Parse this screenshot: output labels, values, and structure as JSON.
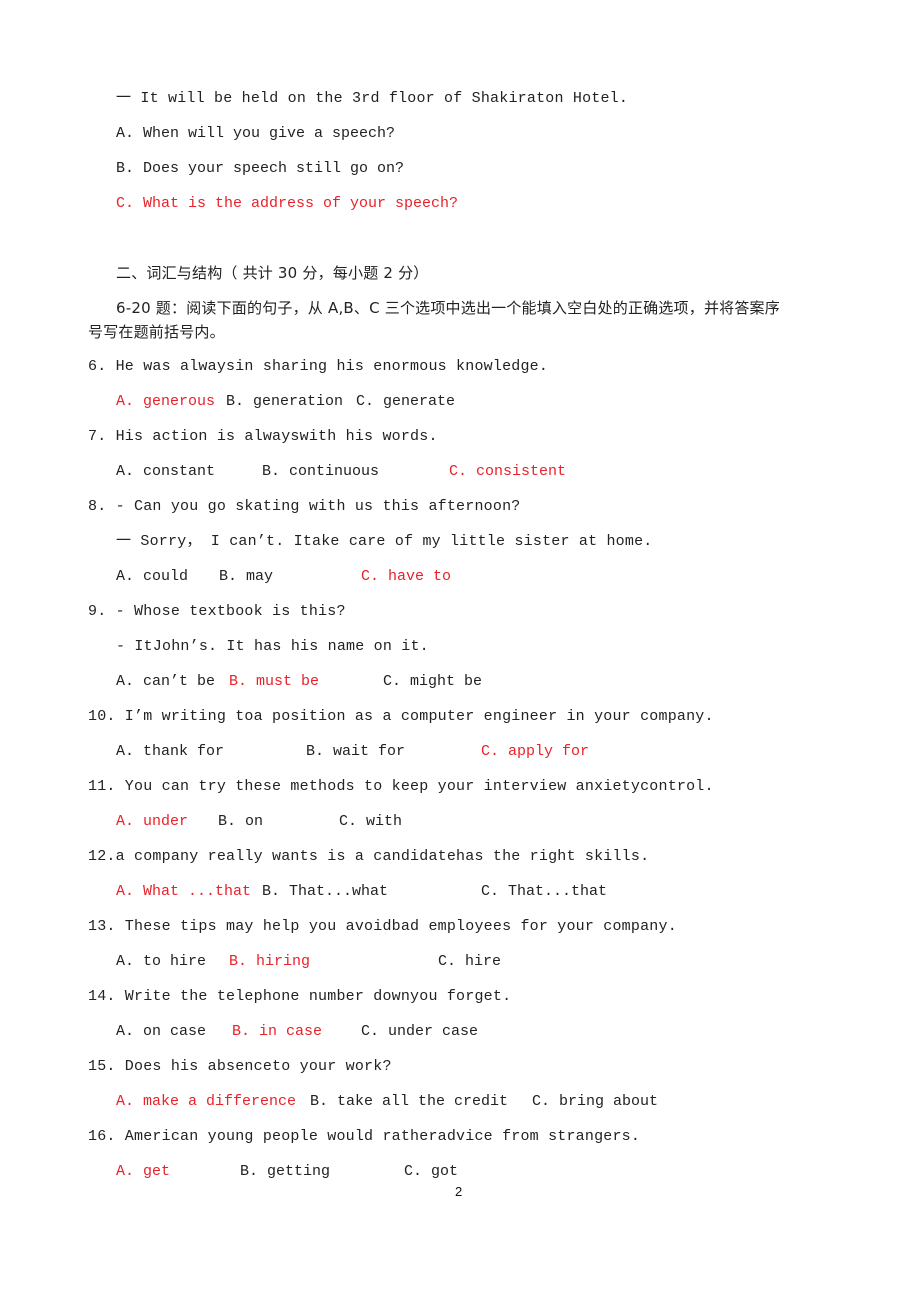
{
  "continuation": {
    "answer_line": "一 It will be held on the 3rd floor of Shakiraton Hotel.",
    "options": [
      {
        "text": "A. When will you give a speech?",
        "correct": false
      },
      {
        "text": "B. Does your speech still go on?",
        "correct": false
      },
      {
        "text": "C. What is the address of your speech?",
        "correct": true
      }
    ]
  },
  "section": {
    "heading": "二、词汇与结构（ 共计 30 分，每小题 2 分）",
    "instruction_line1": "6-20 题：阅读下面的句子，从 A,B、C 三个选项中选出一个能填入空白处的正确选项，并将答案序",
    "instruction_line2": "号写在题前括号内。"
  },
  "questions": [
    {
      "number": "6",
      "stem": "6. He was alwaysin sharing his enormous knowledge.",
      "options": [
        {
          "text": "A. generous",
          "correct": true
        },
        {
          "text": "B. generation",
          "correct": false
        },
        {
          "text": "C. generate",
          "correct": false
        }
      ]
    },
    {
      "number": "7",
      "stem": "7. His action is alwayswith his words.",
      "options": [
        {
          "text": "A. constant",
          "correct": false
        },
        {
          "text": "B. continuous",
          "correct": false
        },
        {
          "text": "C. consistent",
          "correct": true
        }
      ]
    },
    {
      "number": "8",
      "stem": "8. - Can you go skating with us this afternoon?",
      "reply": "一 Sorry， I can’t. Itake care of my little sister at home.",
      "options": [
        {
          "text": "A. could",
          "correct": false
        },
        {
          "text": "B. may",
          "correct": false
        },
        {
          "text": "C. have to",
          "correct": true
        }
      ]
    },
    {
      "number": "9",
      "stem": "9. - Whose textbook is this?",
      "reply": "- ItJohn’s. It has his name on it.",
      "options": [
        {
          "text": "A. can’t be",
          "correct": false
        },
        {
          "text": "B. must be",
          "correct": true
        },
        {
          "text": "C. might be",
          "correct": false
        }
      ]
    },
    {
      "number": "10",
      "stem": "10. I’m writing toa position as a computer engineer in your company.",
      "options": [
        {
          "text": "A. thank for",
          "correct": false
        },
        {
          "text": "B. wait for",
          "correct": false
        },
        {
          "text": "C. apply for",
          "correct": true
        }
      ]
    },
    {
      "number": "11",
      "stem": "11. You can try these methods to keep your interview anxietycontrol.",
      "options": [
        {
          "text": "A. under",
          "correct": true
        },
        {
          "text": "B. on",
          "correct": false
        },
        {
          "text": "C. with",
          "correct": false
        }
      ]
    },
    {
      "number": "12",
      "stem": "12.a company really wants is a candidatehas the right skills.",
      "options": [
        {
          "text": "A. What ...that",
          "correct": true
        },
        {
          "text": "B. That...what",
          "correct": false
        },
        {
          "text": "C. That...that",
          "correct": false
        }
      ]
    },
    {
      "number": "13",
      "stem": "13. These tips may help you avoidbad employees for your company.",
      "options": [
        {
          "text": "A. to hire",
          "correct": false
        },
        {
          "text": "B. hiring",
          "correct": true
        },
        {
          "text": "C. hire",
          "correct": false
        }
      ]
    },
    {
      "number": "14",
      "stem": "14. Write the telephone number downyou forget.",
      "options": [
        {
          "text": "A. on case",
          "correct": false
        },
        {
          "text": "B. in case",
          "correct": true
        },
        {
          "text": "C. under case",
          "correct": false
        }
      ]
    },
    {
      "number": "15",
      "stem": "15. Does his absenceto your work?",
      "options": [
        {
          "text": "A. make a difference",
          "correct": true
        },
        {
          "text": "B. take all the credit",
          "correct": false
        },
        {
          "text": "C. bring about",
          "correct": false
        }
      ]
    },
    {
      "number": "16",
      "stem": "16. American young people would ratheradvice from strangers.",
      "options": [
        {
          "text": "A. get",
          "correct": true
        },
        {
          "text": "B. getting",
          "correct": false
        },
        {
          "text": "C. got",
          "correct": false
        }
      ]
    }
  ],
  "footer": {
    "page_number": "2"
  },
  "colors": {
    "text": "#222222",
    "correct_answer": "#e8222a"
  }
}
